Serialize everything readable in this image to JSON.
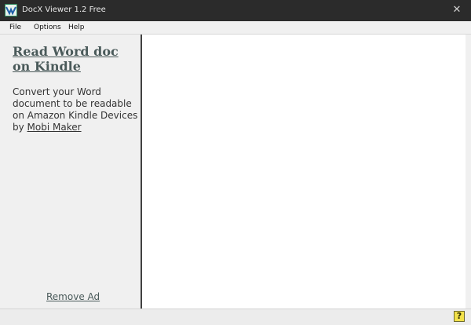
{
  "window": {
    "title": "DocX Viewer 1.2 Free",
    "close_symbol": "✕"
  },
  "menu": {
    "items": [
      {
        "label": "File"
      },
      {
        "label": "Options"
      },
      {
        "label": "Help"
      }
    ]
  },
  "ad": {
    "title": "Read Word doc on Kindle",
    "desc_prefix": "Convert your Word document to be readable on Amazon Kindle Devices by ",
    "link_text": "Mobi Maker",
    "remove_label": "Remove Ad"
  },
  "status": {
    "help_symbol": "?"
  },
  "colors": {
    "titlebar": "#2b2b2b",
    "link": "#4a5a5a",
    "divider": "#404040",
    "help_icon": "#f3e24a"
  },
  "icons": {
    "app": "app-icon",
    "close": "close-icon",
    "help": "help-icon"
  }
}
